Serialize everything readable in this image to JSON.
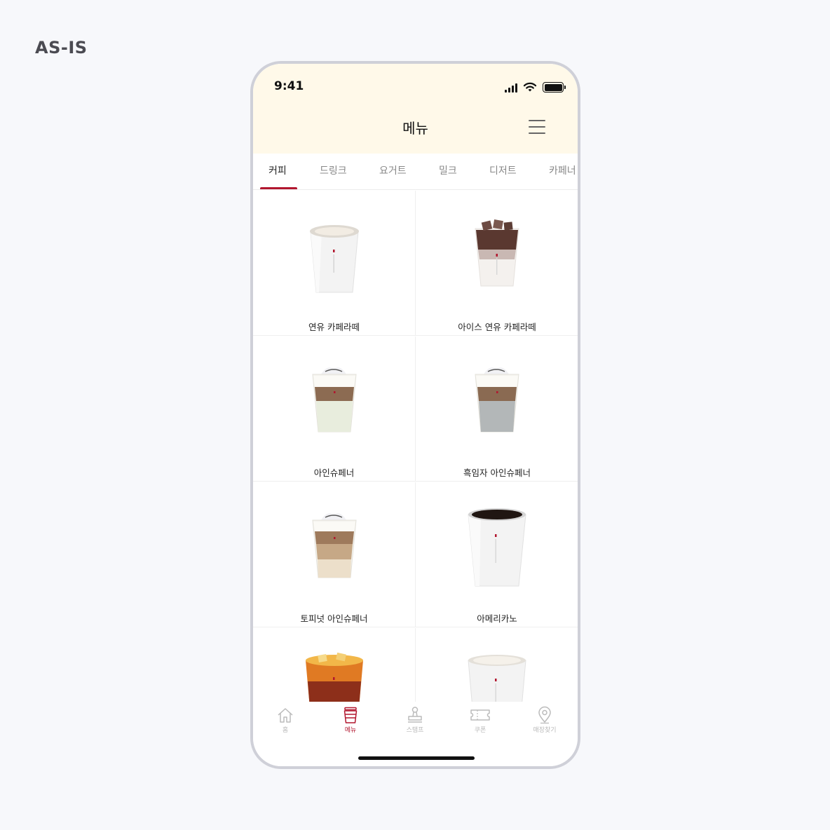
{
  "page_label": "AS-IS",
  "status_bar": {
    "time": "9:41"
  },
  "header": {
    "title": "메뉴"
  },
  "tabs": [
    {
      "label": "커피"
    },
    {
      "label": "드링크"
    },
    {
      "label": "요거트"
    },
    {
      "label": "밀크"
    },
    {
      "label": "디저트"
    },
    {
      "label": "카페너"
    }
  ],
  "menu_items": [
    {
      "name": "연유 카페라떼"
    },
    {
      "name": "아이스 연유 카페라떼"
    },
    {
      "name": "아인슈페너"
    },
    {
      "name": "흑임자 아인슈페너"
    },
    {
      "name": "토피넛 아인슈페너"
    },
    {
      "name": "아메리카노"
    }
  ],
  "bottom_nav": [
    {
      "label": "홈",
      "icon": "home-icon"
    },
    {
      "label": "메뉴",
      "icon": "cup-icon"
    },
    {
      "label": "스탬프",
      "icon": "stamp-icon"
    },
    {
      "label": "쿠폰",
      "icon": "coupon-icon"
    },
    {
      "label": "매장찾기",
      "icon": "location-pin-icon"
    }
  ],
  "colors": {
    "accent": "#b2172f",
    "header_bg": "#fff9e9",
    "page_bg": "#f7f8fb"
  }
}
